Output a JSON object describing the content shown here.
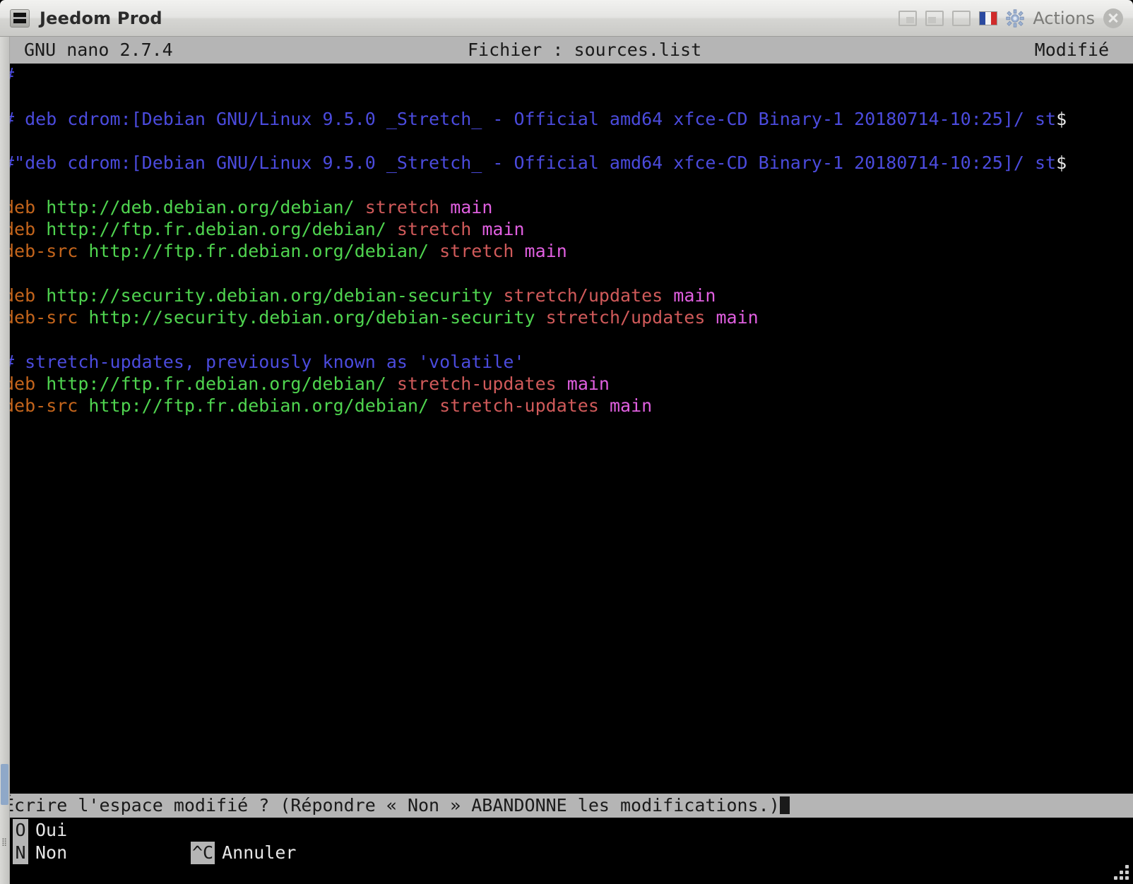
{
  "window": {
    "title": "Jeedom Prod",
    "icon": "terminal-icon",
    "controls": {
      "shade_label": "shade-window",
      "minimize_label": "minimize-window",
      "maximize_label": "maximize-window",
      "flag_label": "french-flag",
      "gear_label": "gear-icon",
      "actions_label": "Actions",
      "close_label": "close-window"
    }
  },
  "nano": {
    "version": "GNU nano 2.7.4",
    "file_label": "Fichier : sources.list",
    "modified_label": "Modifié"
  },
  "editor": {
    "lines": [
      {
        "segments": [
          {
            "text": "#",
            "color": "comment"
          }
        ]
      },
      {
        "segments": []
      },
      {
        "segments": [
          {
            "text": "# deb cdrom:[Debian GNU/Linux 9.5.0 _Stretch_ - Official amd64 xfce-CD Binary-1 20180714-10:25]/ st",
            "color": "comment"
          },
          {
            "text": "$",
            "color": "cont"
          }
        ]
      },
      {
        "segments": []
      },
      {
        "segments": [
          {
            "text": "#\"deb cdrom:[Debian GNU/Linux 9.5.0 _Stretch_ - Official amd64 xfce-CD Binary-1 20180714-10:25]/ st",
            "color": "comment"
          },
          {
            "text": "$",
            "color": "cont"
          }
        ]
      },
      {
        "segments": []
      },
      {
        "segments": [
          {
            "text": "deb",
            "color": "deb"
          },
          {
            "text": " ",
            "color": "plain"
          },
          {
            "text": "http://deb.debian.org/debian/",
            "color": "url"
          },
          {
            "text": " ",
            "color": "plain"
          },
          {
            "text": "stretch",
            "color": "dist"
          },
          {
            "text": " ",
            "color": "plain"
          },
          {
            "text": "main",
            "color": "comp"
          }
        ]
      },
      {
        "segments": [
          {
            "text": "deb",
            "color": "deb"
          },
          {
            "text": " ",
            "color": "plain"
          },
          {
            "text": "http://ftp.fr.debian.org/debian/",
            "color": "url"
          },
          {
            "text": " ",
            "color": "plain"
          },
          {
            "text": "stretch",
            "color": "dist"
          },
          {
            "text": " ",
            "color": "plain"
          },
          {
            "text": "main",
            "color": "comp"
          }
        ]
      },
      {
        "segments": [
          {
            "text": "deb-src",
            "color": "deb"
          },
          {
            "text": " ",
            "color": "plain"
          },
          {
            "text": "http://ftp.fr.debian.org/debian/",
            "color": "url"
          },
          {
            "text": " ",
            "color": "plain"
          },
          {
            "text": "stretch",
            "color": "dist"
          },
          {
            "text": " ",
            "color": "plain"
          },
          {
            "text": "main",
            "color": "comp"
          }
        ]
      },
      {
        "segments": []
      },
      {
        "segments": [
          {
            "text": "deb",
            "color": "deb"
          },
          {
            "text": " ",
            "color": "plain"
          },
          {
            "text": "http://security.debian.org/debian-security",
            "color": "url"
          },
          {
            "text": " ",
            "color": "plain"
          },
          {
            "text": "stretch/updates",
            "color": "dist"
          },
          {
            "text": " ",
            "color": "plain"
          },
          {
            "text": "main",
            "color": "comp"
          }
        ]
      },
      {
        "segments": [
          {
            "text": "deb-src",
            "color": "deb"
          },
          {
            "text": " ",
            "color": "plain"
          },
          {
            "text": "http://security.debian.org/debian-security",
            "color": "url"
          },
          {
            "text": " ",
            "color": "plain"
          },
          {
            "text": "stretch/updates",
            "color": "dist"
          },
          {
            "text": " ",
            "color": "plain"
          },
          {
            "text": "main",
            "color": "comp"
          }
        ]
      },
      {
        "segments": []
      },
      {
        "segments": [
          {
            "text": "# stretch-updates, previously known as 'volatile'",
            "color": "comment"
          }
        ]
      },
      {
        "segments": [
          {
            "text": "deb",
            "color": "deb"
          },
          {
            "text": " ",
            "color": "plain"
          },
          {
            "text": "http://ftp.fr.debian.org/debian/",
            "color": "url"
          },
          {
            "text": " ",
            "color": "plain"
          },
          {
            "text": "stretch-updates",
            "color": "dist"
          },
          {
            "text": " ",
            "color": "plain"
          },
          {
            "text": "main",
            "color": "comp"
          }
        ]
      },
      {
        "segments": [
          {
            "text": "deb-src",
            "color": "deb"
          },
          {
            "text": " ",
            "color": "plain"
          },
          {
            "text": "http://ftp.fr.debian.org/debian/",
            "color": "url"
          },
          {
            "text": " ",
            "color": "plain"
          },
          {
            "text": "stretch-updates",
            "color": "dist"
          },
          {
            "text": " ",
            "color": "plain"
          },
          {
            "text": "main",
            "color": "comp"
          }
        ]
      }
    ]
  },
  "prompt": {
    "text": "Écrire l'espace modifié ? (Répondre « Non » ABANDONNE les modifications.)"
  },
  "menu": {
    "row1": [
      {
        "key": "O",
        "label": "Oui"
      }
    ],
    "row2": [
      {
        "key": "N",
        "label": "Non"
      },
      {
        "key": "^C",
        "label": "Annuler"
      }
    ]
  },
  "colors": {
    "comment": "#4b4bdd",
    "deb": "#c4651c",
    "url": "#4fd44f",
    "dist": "#d05a5a",
    "component": "#e05fe0",
    "continuation": "#e8e8e8",
    "header_bar": "#b5b5b5",
    "titlebar": "#e4e4e2",
    "background": "#000000"
  }
}
